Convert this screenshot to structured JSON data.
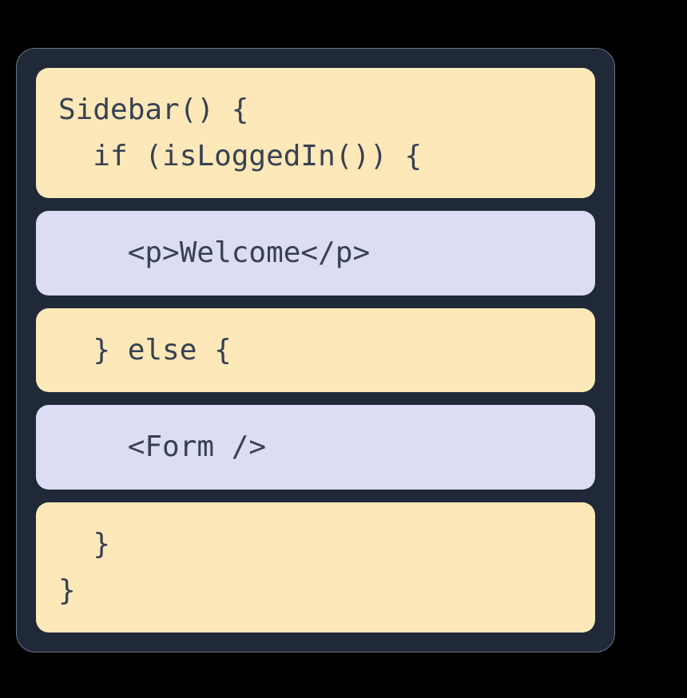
{
  "blocks": [
    {
      "color": "yellow",
      "text": "Sidebar() {\n  if (isLoggedIn()) {"
    },
    {
      "color": "purple",
      "text": "    <p>Welcome</p>"
    },
    {
      "color": "yellow",
      "text": "  } else {"
    },
    {
      "color": "purple",
      "text": "    <Form />"
    },
    {
      "color": "yellow",
      "text": "  }\n}"
    }
  ]
}
